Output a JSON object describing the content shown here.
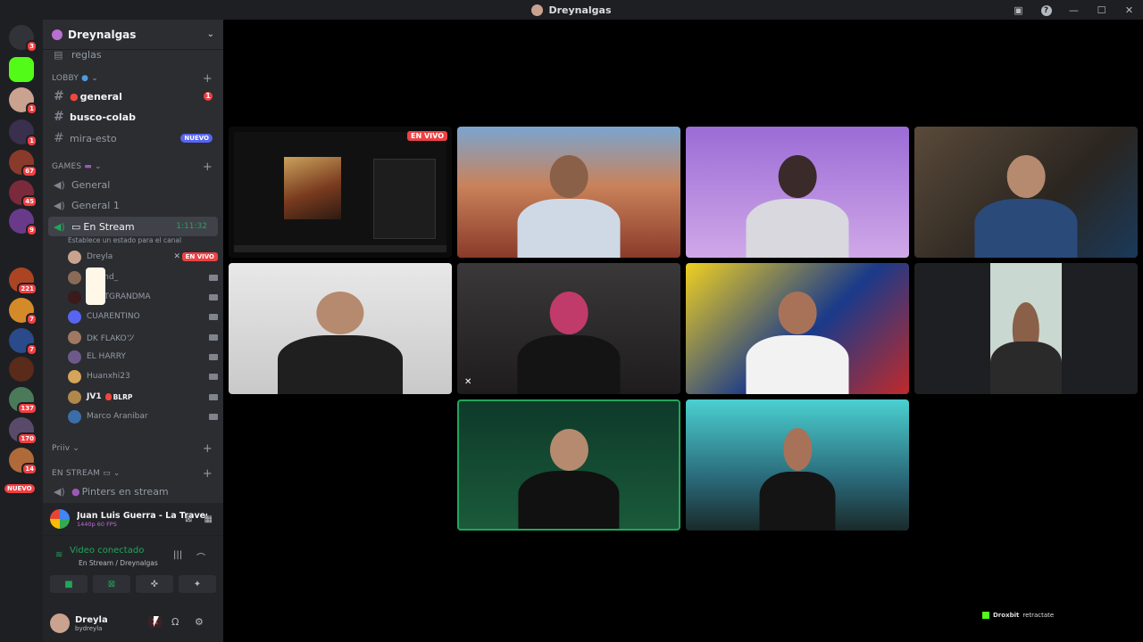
{
  "window": {
    "title": "Dreynalgas"
  },
  "guild_rail": {
    "badges": [
      "3",
      "1",
      "1",
      "67",
      "45",
      "9",
      "221",
      "7",
      "7",
      "137",
      "170",
      "14"
    ],
    "nuevo_label": "NUEVO"
  },
  "server": {
    "name": "Dreynalgas"
  },
  "channels": {
    "partial_top": "reglas",
    "lobby_label": "LOBBY",
    "general": {
      "name": "general",
      "badge": "1"
    },
    "busco_colab": "busco-colab",
    "mira_esto": {
      "name": "mira-esto",
      "tag": "NUEVO"
    },
    "games_label": "GAMES",
    "voice_general": "General",
    "voice_general1": "General 1",
    "en_stream": {
      "name": "En Stream",
      "timer": "1:11:32",
      "status_hint": "Establece un estado para el canal"
    },
    "priv_label": "Priiv",
    "en_stream_cat": "EN STREAM",
    "pinters": "Pinters en stream"
  },
  "members": [
    {
      "name": "Dreyla",
      "live": "EN VIVO",
      "color": "#c9a38f"
    },
    {
      "name": "aldend_",
      "color": "#8a6b58"
    },
    {
      "name": "AUNTGRANDMA",
      "color": "#3a1a1a"
    },
    {
      "name": "CUARENTINO",
      "color": "#5865f2"
    },
    {
      "name": "DK FLAKOツ",
      "color": "#a07862"
    },
    {
      "name": "EL HARRY",
      "color": "#6d5a8a"
    },
    {
      "name": "Huanxhi23",
      "color": "#d4a55a"
    },
    {
      "name": "JV1",
      "tag": "BLRP",
      "color": "#b0884b"
    },
    {
      "name": "Marco Aranibar",
      "color": "#3b6ea8"
    }
  ],
  "activity": {
    "title": "Juan Luis Guerra - La Travesía...",
    "quality": "1440p 60 FPS"
  },
  "voice": {
    "status": "Video conectado",
    "location": "En Stream / Dreynalgas"
  },
  "user": {
    "name": "Dreyla",
    "handle": "bydreyla"
  },
  "stage": {
    "live_label": "EN VIVO"
  },
  "watermark": {
    "brand": "Droxbit",
    "text": "retractate"
  },
  "colors": {
    "accent_green": "#23a55a",
    "live_red": "#ed4245",
    "blurple": "#5865f2"
  }
}
